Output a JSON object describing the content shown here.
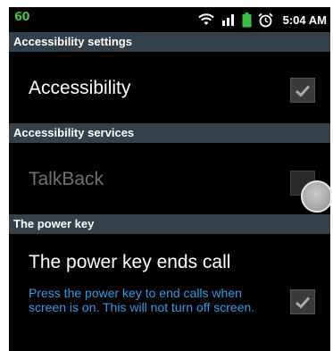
{
  "status_bar": {
    "left_indicator": "60",
    "time": "5:04 AM",
    "icons": [
      "wifi-icon",
      "signal-icon",
      "battery-icon",
      "alarm-icon"
    ]
  },
  "sections": {
    "accessibility_settings": {
      "header": "Accessibility settings",
      "accessibility": {
        "title": "Accessibility",
        "checked": true
      }
    },
    "accessibility_services": {
      "header": "Accessibility services",
      "talkback": {
        "title": "TalkBack",
        "enabled": false
      }
    },
    "power_key": {
      "header": "The power key",
      "ends_call": {
        "title": "The power key ends call",
        "summary": "Press the power key to end calls when screen is on. This will not turn off screen.",
        "checked": true
      }
    }
  },
  "colors": {
    "background": "#000000",
    "section_header": "#34414b",
    "summary_text": "#2b9de0",
    "status_green": "#3fbf3f",
    "disabled_text": "#707070"
  }
}
